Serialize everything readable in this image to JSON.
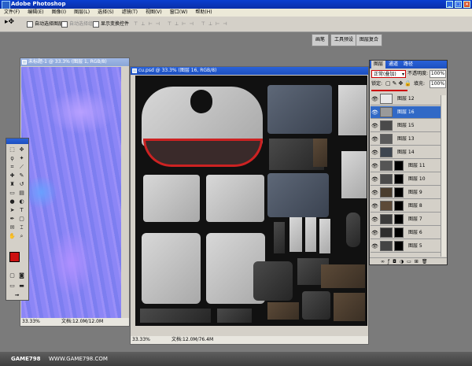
{
  "app": {
    "title": "Adobe Photoshop",
    "menus": [
      "文件(F)",
      "编辑(E)",
      "图像(I)",
      "图层(L)",
      "选择(S)",
      "滤镜(T)",
      "视图(V)",
      "窗口(W)",
      "帮助(H)"
    ]
  },
  "options_bar": {
    "auto_select_layer": "自动选择图层",
    "auto_select_group": "自动选择组",
    "show_transform_controls": "显示变换控件",
    "palette_well_tabs": [
      "画笔",
      "工具预设",
      "图层复合"
    ]
  },
  "normal_doc": {
    "title": "未标题-1 @ 33.3% (图层 1, RGB/8)",
    "zoom": "33.33%",
    "doc_size": "文档:12.0M/12.0M"
  },
  "texture_doc": {
    "title": "cu.psd @ 33.3% (图层 16, RGB/8)",
    "zoom": "33.33%",
    "doc_size": "文档:12.0M/76.4M"
  },
  "layers_panel": {
    "tabs": [
      "图层",
      "通道",
      "路径"
    ],
    "blend_mode": "正常(叠加)",
    "opacity_label": "不透明度:",
    "opacity_value": "100%",
    "lock_label": "锁定:",
    "fill_label": "填充:",
    "fill_value": "100%",
    "layers": [
      {
        "name": "图层 12",
        "selected": false,
        "has_mask": false
      },
      {
        "name": "图层 16",
        "selected": true,
        "has_mask": false
      },
      {
        "name": "图层 15",
        "selected": false,
        "has_mask": false
      },
      {
        "name": "图层 13",
        "selected": false,
        "has_mask": false
      },
      {
        "name": "图层 14",
        "selected": false,
        "has_mask": false
      },
      {
        "name": "图层 11",
        "selected": false,
        "has_mask": true
      },
      {
        "name": "图层 10",
        "selected": false,
        "has_mask": true
      },
      {
        "name": "图层 9",
        "selected": false,
        "has_mask": true
      },
      {
        "name": "图层 8",
        "selected": false,
        "has_mask": true
      },
      {
        "name": "图层 7",
        "selected": false,
        "has_mask": true
      },
      {
        "name": "图层 6",
        "selected": false,
        "has_mask": true
      },
      {
        "name": "图层 5",
        "selected": false,
        "has_mask": true
      }
    ]
  },
  "toolbox": {
    "foreground_color": "#cc1111",
    "background_color": "#ffffff"
  },
  "watermark": {
    "left": "GAME798",
    "right": "WWW.GAME798.COM"
  }
}
